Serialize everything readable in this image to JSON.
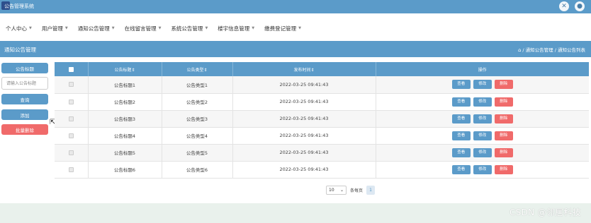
{
  "header": {
    "title": "公告管理系统",
    "icons": [
      "expand-icon",
      "user-icon"
    ]
  },
  "nav": [
    {
      "label": "个人中心"
    },
    {
      "label": "用户管理"
    },
    {
      "label": "通知公告管理"
    },
    {
      "label": "在线留言管理"
    },
    {
      "label": "系统公告管理"
    },
    {
      "label": "楼宇信息管理"
    },
    {
      "label": "缴费登记管理"
    }
  ],
  "section": {
    "title": "通知公告管理",
    "breadcrumb": "/ 通知公告管理 / 通知公告列表"
  },
  "sidebar": {
    "title_button": "公告标题",
    "search_placeholder": "请输入公告标题",
    "search_value": "",
    "query_button": "查询",
    "add_button": "添加",
    "batch_delete_button": "批量删除"
  },
  "table": {
    "headers": [
      "公告标题",
      "公告类型",
      "发布时间",
      "操作"
    ],
    "rows": [
      {
        "title": "公告标题1",
        "type": "公告类型1",
        "time": "2022-03-25 09:41:43"
      },
      {
        "title": "公告标题2",
        "type": "公告类型2",
        "time": "2022-03-25 09:41:43"
      },
      {
        "title": "公告标题3",
        "type": "公告类型3",
        "time": "2022-03-25 09:41:43"
      },
      {
        "title": "公告标题4",
        "type": "公告类型4",
        "time": "2022-03-25 09:41:43"
      },
      {
        "title": "公告标题5",
        "type": "公告类型5",
        "time": "2022-03-25 09:41:43"
      },
      {
        "title": "公告标题6",
        "type": "公告类型6",
        "time": "2022-03-25 09:41:43"
      }
    ],
    "actions": {
      "view": "查看",
      "edit": "修改",
      "delete": "删除"
    }
  },
  "pagination": {
    "page_size": "10",
    "page_size_unit": "条每页",
    "current_page": "1"
  },
  "watermark": "CSDN @邻居科技",
  "colors": {
    "primary": "#5b9bc9",
    "danger": "#f06a6a",
    "footer": "#e9f1ec"
  }
}
